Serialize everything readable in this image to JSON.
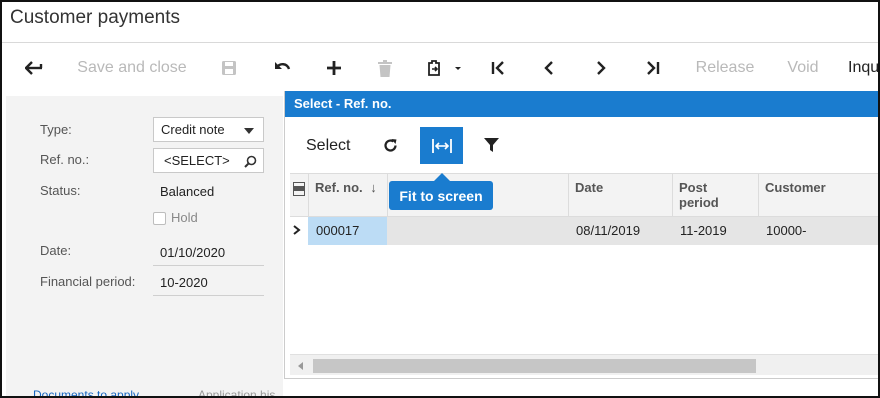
{
  "window": {
    "title": "Customer payments"
  },
  "toolbar": {
    "back_icon": "arrow-left-icon",
    "save_close": "Save and close",
    "release": "Release",
    "void": "Void",
    "inquiries": "Inqu"
  },
  "form": {
    "type_label": "Type:",
    "type_value": "Credit note",
    "refno_label": "Ref. no.:",
    "refno_value": "<SELECT>",
    "status_label": "Status:",
    "status_value": "Balanced",
    "hold_label": "Hold",
    "date_label": "Date:",
    "date_value": "01/10/2020",
    "period_label": "Financial period:",
    "period_value": "10-2020",
    "tab_documents": "Documents to apply",
    "tab_history": "Application his"
  },
  "dialog": {
    "title": "Select - Ref. no.",
    "select_label": "Select",
    "tooltip": "Fit to screen",
    "accent": "#1a7ccf",
    "columns": {
      "refno": "Ref. no.",
      "date": "Date",
      "post_period_l1": "Post",
      "post_period_l2": "period",
      "customer": "Customer"
    },
    "rows": [
      {
        "refno": "000017",
        "date": "08/11/2019",
        "post_period": "11-2019",
        "customer": "10000-"
      }
    ]
  }
}
